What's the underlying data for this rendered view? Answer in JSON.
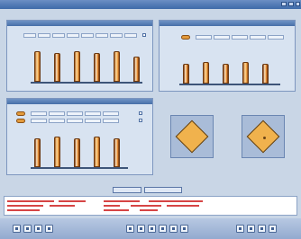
{
  "window": {
    "title": ""
  },
  "panels": [
    {
      "id": "top-left",
      "title": ""
    },
    {
      "id": "top-right",
      "title": ""
    },
    {
      "id": "bottom-left",
      "title": ""
    }
  ],
  "charts": {
    "top_left_bar_count": 6,
    "top_right_bar_count": 5,
    "bottom_left_bar_count": 5
  },
  "colors": {
    "accent_blue": "#476fa8",
    "bar_orange": "#f3a647",
    "log_red": "#d64545"
  },
  "toolbar": {
    "button_icons": [
      "prev-icon",
      "next-icon",
      "stop-icon",
      "play-icon",
      "rewind-icon",
      "forward-icon",
      "record-icon",
      "pause-icon",
      "zoom-in-icon",
      "zoom-out-icon",
      "refresh-icon",
      "settings-icon",
      "help-icon",
      "close-icon"
    ]
  }
}
